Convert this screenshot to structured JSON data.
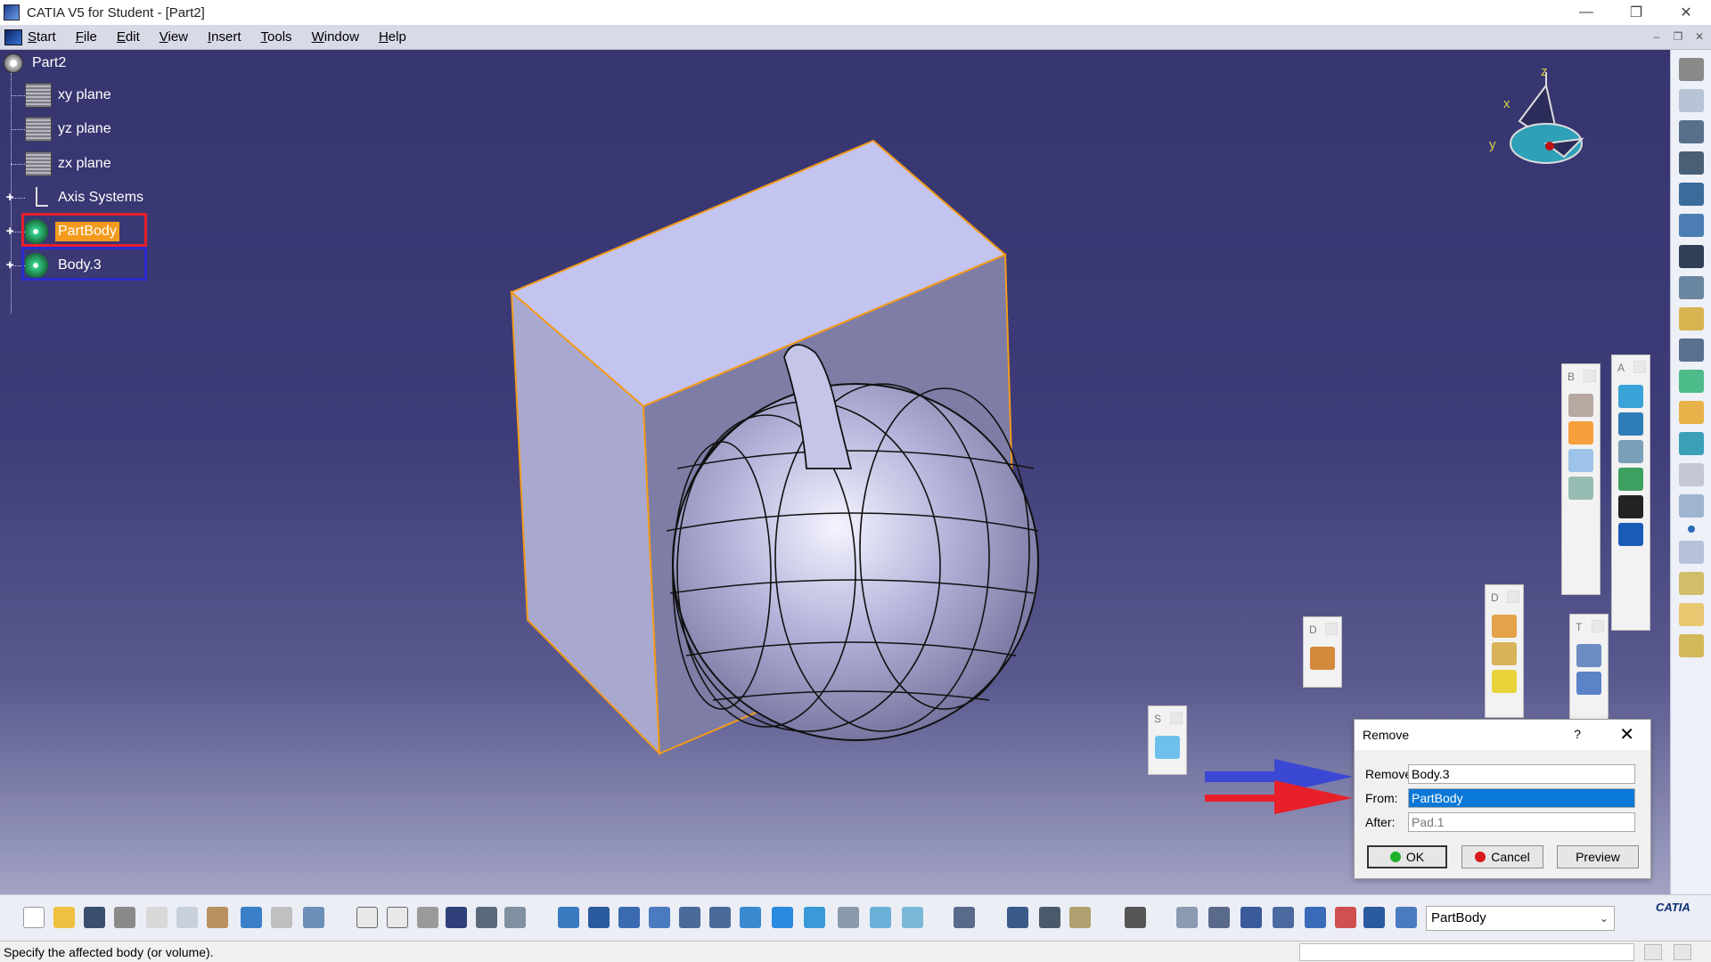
{
  "window": {
    "title": "CATIA V5 for Student - [Part2]",
    "controls": [
      "minimize",
      "restore",
      "close"
    ]
  },
  "menubar": {
    "items": [
      {
        "label": "Start",
        "underline": "S"
      },
      {
        "label": "File",
        "underline": "F"
      },
      {
        "label": "Edit",
        "underline": "E"
      },
      {
        "label": "View",
        "underline": "V"
      },
      {
        "label": "Insert",
        "underline": "I"
      },
      {
        "label": "Tools",
        "underline": "T"
      },
      {
        "label": "Window",
        "underline": "W"
      },
      {
        "label": "Help",
        "underline": "H"
      }
    ]
  },
  "tree": {
    "root": "Part2",
    "nodes": [
      {
        "label": "xy plane",
        "icon": "plane-icon"
      },
      {
        "label": "yz plane",
        "icon": "plane-icon"
      },
      {
        "label": "zx plane",
        "icon": "plane-icon"
      },
      {
        "label": "Axis Systems",
        "icon": "axis-system-icon"
      },
      {
        "label": "PartBody",
        "icon": "body-icon",
        "selected": true
      },
      {
        "label": "Body.3",
        "icon": "body-icon"
      }
    ],
    "highlight_colors": {
      "partbody": "#e8202a",
      "body3": "#2a2ad0"
    }
  },
  "compass": {
    "x": "x",
    "y": "y",
    "z": "z"
  },
  "floating_toolbars": {
    "b": "B",
    "a": "A",
    "c1": "D",
    "c2": "D",
    "t": "T",
    "s": "S"
  },
  "dialog": {
    "title": "Remove",
    "help": "?",
    "remove_label": "Remove",
    "remove_value": "Body.3",
    "from_label": "From:",
    "from_value": "PartBody",
    "after_label": "After:",
    "after_value": "Pad.1",
    "ok_label": "OK",
    "cancel_label": "Cancel",
    "preview_label": "Preview"
  },
  "arrows": {
    "blue": "#3a48d4",
    "red": "#e8202a"
  },
  "bottom_toolbar": {
    "current_body": "PartBody",
    "logo_text": "CATIA"
  },
  "status": {
    "message": "Specify the affected body (or volume)."
  },
  "colors": {
    "viewport_top": "#36356f",
    "viewport_bottom": "#a2a3c4",
    "selection_orange": "#f39a1c",
    "edge_orange": "#f39a1c",
    "model_fill": "#b9b9e8"
  }
}
